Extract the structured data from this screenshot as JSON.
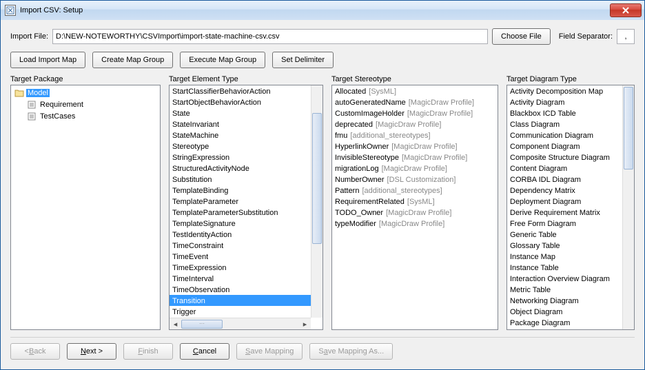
{
  "window": {
    "title": "Import CSV: Setup"
  },
  "toolbar": {
    "import_file_label": "Import File:",
    "import_file_value": "D:\\NEW-NOTEWORTHY\\CSVImport\\import-state-machine-csv.csv",
    "choose_file": "Choose File",
    "field_separator_label": "Field Separator:",
    "field_separator_value": ",",
    "load_import_map": "Load Import Map",
    "create_map_group": "Create Map Group",
    "execute_map_group": "Execute Map Group",
    "set_delimiter": "Set Delimiter"
  },
  "cols": {
    "package_label": "Target Package",
    "element_label": "Target Element Type",
    "stereotype_label": "Target Stereotype",
    "diagram_label": "Target Diagram Type"
  },
  "tree": {
    "root": "Model",
    "children": [
      "Requirement",
      "TestCases"
    ]
  },
  "elements": [
    "StartClassifierBehaviorAction",
    "StartObjectBehaviorAction",
    "State",
    "StateInvariant",
    "StateMachine",
    "Stereotype",
    "StringExpression",
    "StructuredActivityNode",
    "Substitution",
    "TemplateBinding",
    "TemplateParameter",
    "TemplateParameterSubstitution",
    "TemplateSignature",
    "TestIdentityAction",
    "TimeConstraint",
    "TimeEvent",
    "TimeExpression",
    "TimeInterval",
    "TimeObservation",
    "Transition",
    "Trigger"
  ],
  "elements_selected": "Transition",
  "stereotypes": [
    {
      "name": "Allocated",
      "extra": "[SysML]"
    },
    {
      "name": "autoGeneratedName",
      "extra": "[MagicDraw Profile]"
    },
    {
      "name": "CustomImageHolder",
      "extra": "[MagicDraw Profile]"
    },
    {
      "name": "deprecated",
      "extra": "[MagicDraw Profile]"
    },
    {
      "name": "fmu",
      "extra": "[additional_stereotypes]"
    },
    {
      "name": "HyperlinkOwner",
      "extra": "[MagicDraw Profile]"
    },
    {
      "name": "InvisibleStereotype",
      "extra": "[MagicDraw Profile]"
    },
    {
      "name": "migrationLog",
      "extra": "[MagicDraw Profile]"
    },
    {
      "name": "NumberOwner",
      "extra": "[DSL Customization]"
    },
    {
      "name": "Pattern",
      "extra": "[additional_stereotypes]"
    },
    {
      "name": "RequirementRelated",
      "extra": "[SysML]"
    },
    {
      "name": "TODO_Owner",
      "extra": "[MagicDraw Profile]"
    },
    {
      "name": "typeModifier",
      "extra": "[MagicDraw Profile]"
    }
  ],
  "diagrams": [
    "Activity Decomposition Map",
    "Activity Diagram",
    "Blackbox ICD Table",
    "Class Diagram",
    "Communication Diagram",
    "Component Diagram",
    "Composite Structure Diagram",
    "Content Diagram",
    "CORBA IDL Diagram",
    "Dependency Matrix",
    "Deployment Diagram",
    "Derive Requirement Matrix",
    "Free Form Diagram",
    "Generic Table",
    "Glossary Table",
    "Instance Map",
    "Instance Table",
    "Interaction Overview Diagram",
    "Metric Table",
    "Networking Diagram",
    "Object Diagram",
    "Package Diagram"
  ],
  "footer": {
    "back": "Back",
    "next": "Next >",
    "finish": "Finish",
    "cancel": "Cancel",
    "save_mapping": "Save Mapping",
    "save_mapping_as": "Save Mapping As..."
  }
}
